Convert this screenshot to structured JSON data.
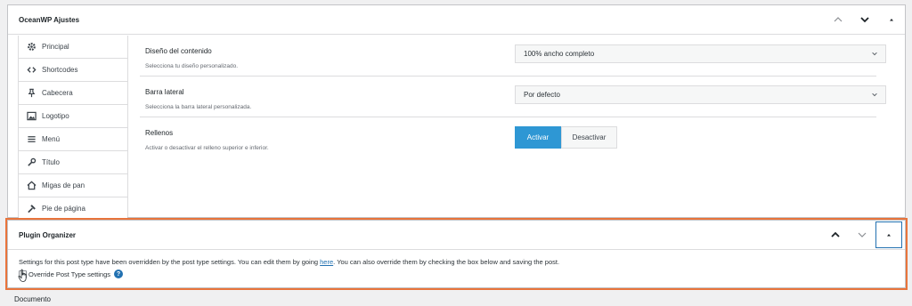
{
  "oceanwp": {
    "title": "OceanWP Ajustes",
    "sidebar": [
      {
        "label": "Principal",
        "icon": "gear-icon"
      },
      {
        "label": "Shortcodes",
        "icon": "code-icon"
      },
      {
        "label": "Cabecera",
        "icon": "pin-icon"
      },
      {
        "label": "Logotipo",
        "icon": "image-icon"
      },
      {
        "label": "Menú",
        "icon": "menu-icon"
      },
      {
        "label": "Título",
        "icon": "wrench-icon"
      },
      {
        "label": "Migas de pan",
        "icon": "home-icon"
      },
      {
        "label": "Pie de página",
        "icon": "hammer-icon"
      }
    ],
    "settings": {
      "layout": {
        "label": "Diseño del contenido",
        "desc": "Selecciona tu diseño personalizado.",
        "value": "100% ancho completo"
      },
      "sidebar": {
        "label": "Barra lateral",
        "desc": "Selecciona la barra lateral personalizada.",
        "value": "Por defecto"
      },
      "paddings": {
        "label": "Rellenos",
        "desc": "Activar o desactivar el relleno superior e inferior.",
        "on_label": "Activar",
        "off_label": "Desactivar"
      }
    }
  },
  "plugin_organizer": {
    "title": "Plugin Organizer",
    "text_before": "Settings for this post type have been overridden by the post type settings. You can edit them by going ",
    "link_text": "here",
    "text_after": ". You can also override them by checking the box below and saving the post.",
    "override_label": "Override Post Type settings",
    "help_glyph": "?"
  },
  "footer_label": "Documento",
  "colors": {
    "accent": "#2e97d4",
    "highlight": "#e8743b",
    "link": "#2271b1"
  }
}
